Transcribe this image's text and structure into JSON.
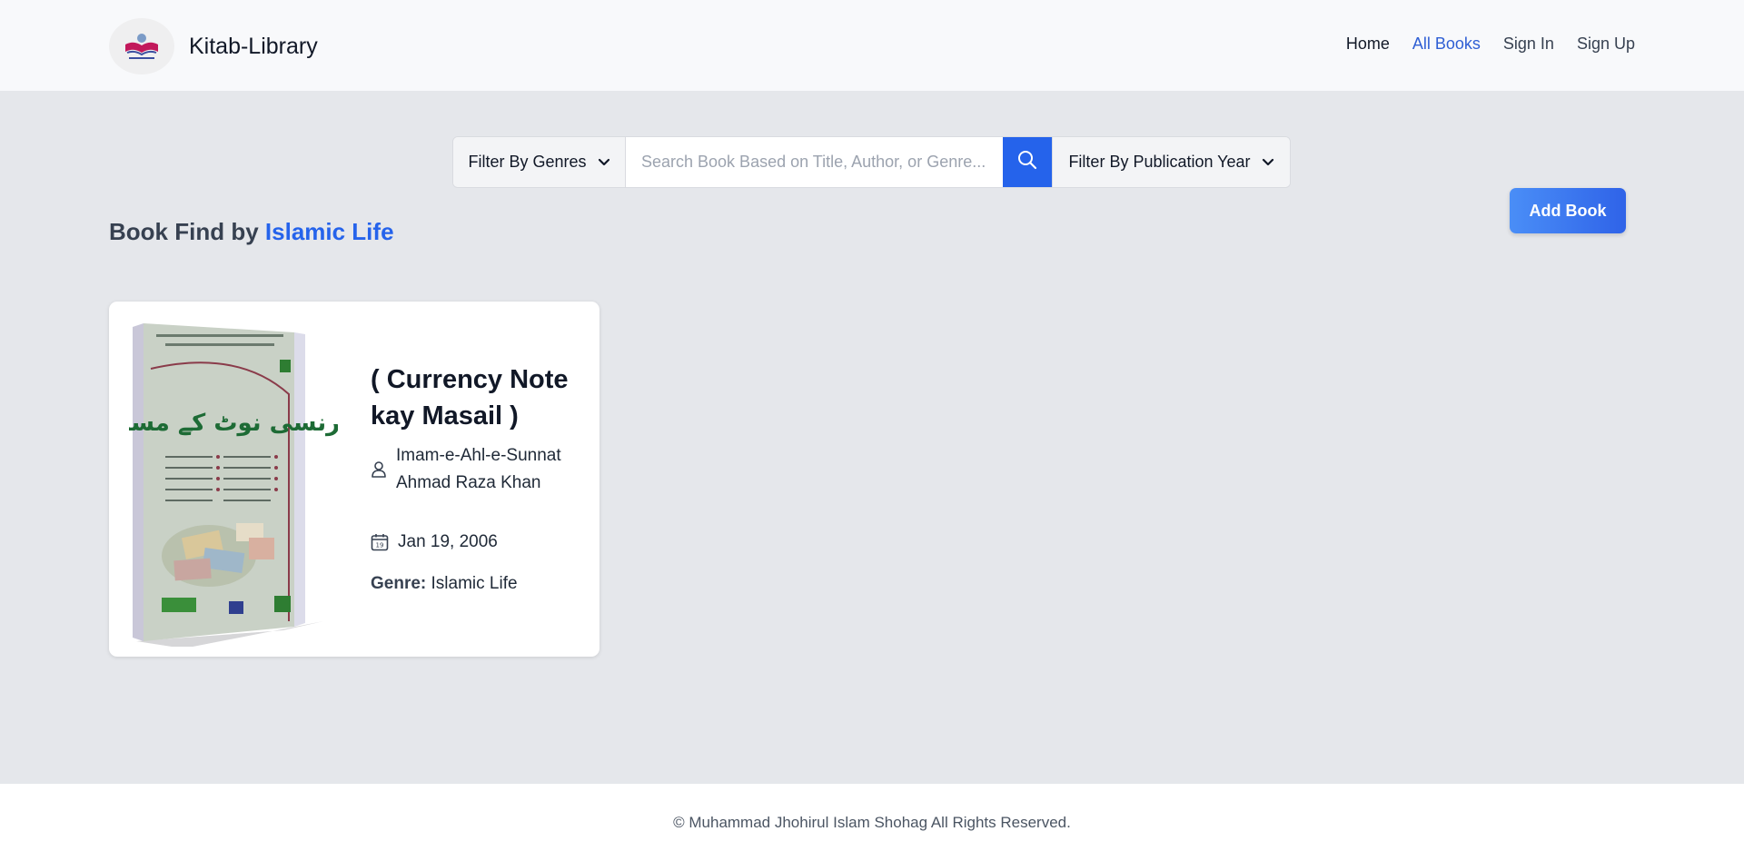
{
  "header": {
    "brand": "Kitab-Library",
    "nav": [
      "Home",
      "All Books",
      "Sign In",
      "Sign Up"
    ],
    "active_nav": "All Books"
  },
  "filters": {
    "genres_label": "Filter By Genres",
    "search_placeholder": "Search Book Based on Title, Author, or Genre...",
    "year_label": "Filter By Publication Year"
  },
  "add_book_label": "Add Book",
  "find": {
    "prefix": "Book Find by",
    "genre": "Islamic Life"
  },
  "books": [
    {
      "title": "( Currency Note kay Masail )",
      "author": "Imam-e-Ahl-e-Sunnat Ahmad Raza Khan",
      "date": "Jan 19, 2006",
      "genre_label": "Genre:",
      "genre": "Islamic Life",
      "cover_title": "کرنسی نوٹ کے مسائل"
    }
  ],
  "footer": {
    "text": "© Muhammad Jhohirul Islam Shohag All Rights Reserved."
  },
  "colors": {
    "accent": "#2563eb",
    "page_bg": "#e5e7eb",
    "header_bg": "#f8f9fb",
    "cover_green": "#1d6b35"
  },
  "icons": {
    "search": "search-icon",
    "chevron": "chevron-down-icon",
    "author": "user-icon",
    "date": "calendar-icon"
  }
}
